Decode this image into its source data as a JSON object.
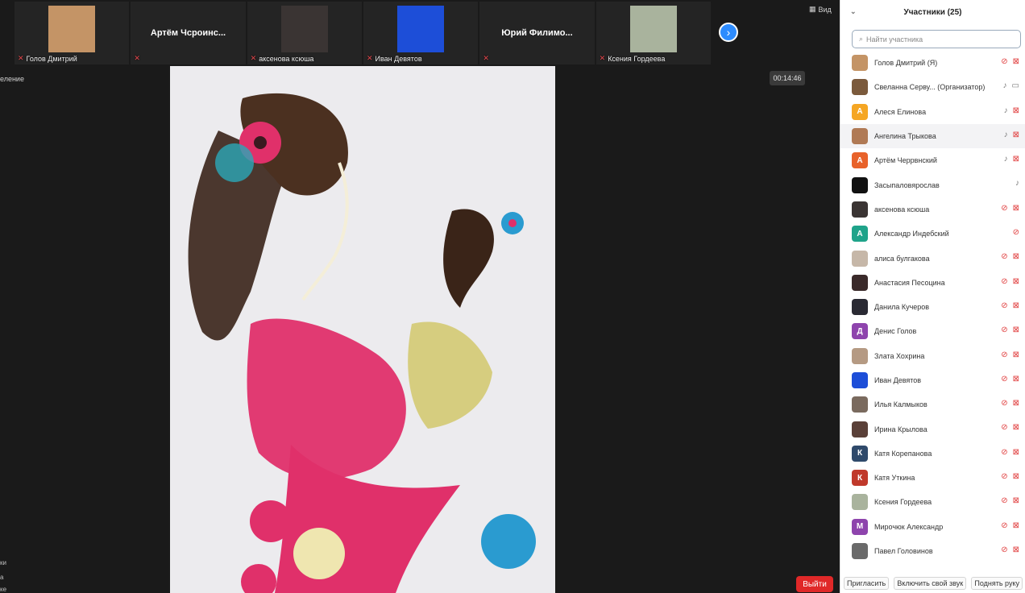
{
  "stage": {
    "view_label": "Вид",
    "left_label": "еление",
    "timer": "00:14:46",
    "leave_label": "Выйти",
    "next_icon": "chevron-right-icon",
    "left_mini": [
      "ки",
      "а",
      "ке"
    ],
    "thumbnails": [
      {
        "name": "Голов Дмитрий",
        "type": "photo",
        "color": "#c49466"
      },
      {
        "name": "",
        "big": "Артём Чсроинс...",
        "type": "name"
      },
      {
        "name": "аксенова ксюша",
        "type": "photo",
        "color": "#3a3433"
      },
      {
        "name": "Иван Девятов",
        "type": "photo",
        "color": "#1d4ed8"
      },
      {
        "name": "",
        "big": "Юрий Филимо...",
        "type": "name"
      },
      {
        "name": "Ксения Гордеева",
        "type": "photo",
        "color": "#a9b39d"
      }
    ]
  },
  "panel": {
    "title": "Участники (25)",
    "search_placeholder": "Найти участника",
    "footer": {
      "invite": "Пригласить",
      "unmute": "Включить свой звук",
      "raise_hand": "Поднять руку"
    },
    "participants": [
      {
        "name": "Голов Дмитрий (Я)",
        "avatar": "",
        "color": "#c49466",
        "mic": "mute",
        "cam": "mute"
      },
      {
        "name": "Свеланна Серву... (Организатор)",
        "avatar": "",
        "color": "#7b5a3c",
        "mic": "on",
        "cam": "on"
      },
      {
        "name": "Алеся Елинова",
        "avatar": "А",
        "color": "#f5a623",
        "mic": "on",
        "cam": "mute"
      },
      {
        "name": "Ангелина Трыкова",
        "avatar": "",
        "color": "#b07a55",
        "mic": "on",
        "cam": "mute",
        "hl": true
      },
      {
        "name": "Артём Черрвнский",
        "avatar": "А",
        "color": "#e8622a",
        "mic": "on",
        "cam": "mute"
      },
      {
        "name": "Засыпаловярослав",
        "avatar": "",
        "color": "#111111",
        "mic": "on",
        "cam": ""
      },
      {
        "name": "аксенова ксюша",
        "avatar": "",
        "color": "#3a3433",
        "mic": "mute",
        "cam": "mute"
      },
      {
        "name": "Александр Индебский",
        "avatar": "А",
        "color": "#1fa38a",
        "mic": "mute",
        "cam": ""
      },
      {
        "name": "алиса булгакова",
        "avatar": "",
        "color": "#c6b7a8",
        "mic": "mute",
        "cam": "mute"
      },
      {
        "name": "Анастасия Песоцина",
        "avatar": "",
        "color": "#3a2a2a",
        "mic": "mute",
        "cam": "mute"
      },
      {
        "name": "Данила Кучеров",
        "avatar": "",
        "color": "#2a2a33",
        "mic": "mute",
        "cam": "mute"
      },
      {
        "name": "Денис Голов",
        "avatar": "Д",
        "color": "#8e44ad",
        "mic": "mute",
        "cam": "mute"
      },
      {
        "name": "Злата Хохрина",
        "avatar": "",
        "color": "#b59a83",
        "mic": "mute",
        "cam": "mute"
      },
      {
        "name": "Иван Девятов",
        "avatar": "",
        "color": "#1d4ed8",
        "mic": "mute",
        "cam": "mute"
      },
      {
        "name": "Илья Калмыков",
        "avatar": "",
        "color": "#7a6a5e",
        "mic": "mute",
        "cam": "mute"
      },
      {
        "name": "Ирина Крылова",
        "avatar": "",
        "color": "#5a4038",
        "mic": "mute",
        "cam": "mute"
      },
      {
        "name": "Катя Корепанова",
        "avatar": "К",
        "color": "#2f4a6b",
        "mic": "mute",
        "cam": "mute"
      },
      {
        "name": "Катя Уткина",
        "avatar": "К",
        "color": "#c0392b",
        "mic": "mute",
        "cam": "mute"
      },
      {
        "name": "Ксения Гордеева",
        "avatar": "",
        "color": "#a9b39d",
        "mic": "mute",
        "cam": "mute"
      },
      {
        "name": "Мирочюк Александр",
        "avatar": "М",
        "color": "#8e44ad",
        "mic": "mute",
        "cam": "mute"
      },
      {
        "name": "Павел Головинов",
        "avatar": "",
        "color": "#6a6a6a",
        "mic": "mute",
        "cam": "mute"
      }
    ]
  }
}
